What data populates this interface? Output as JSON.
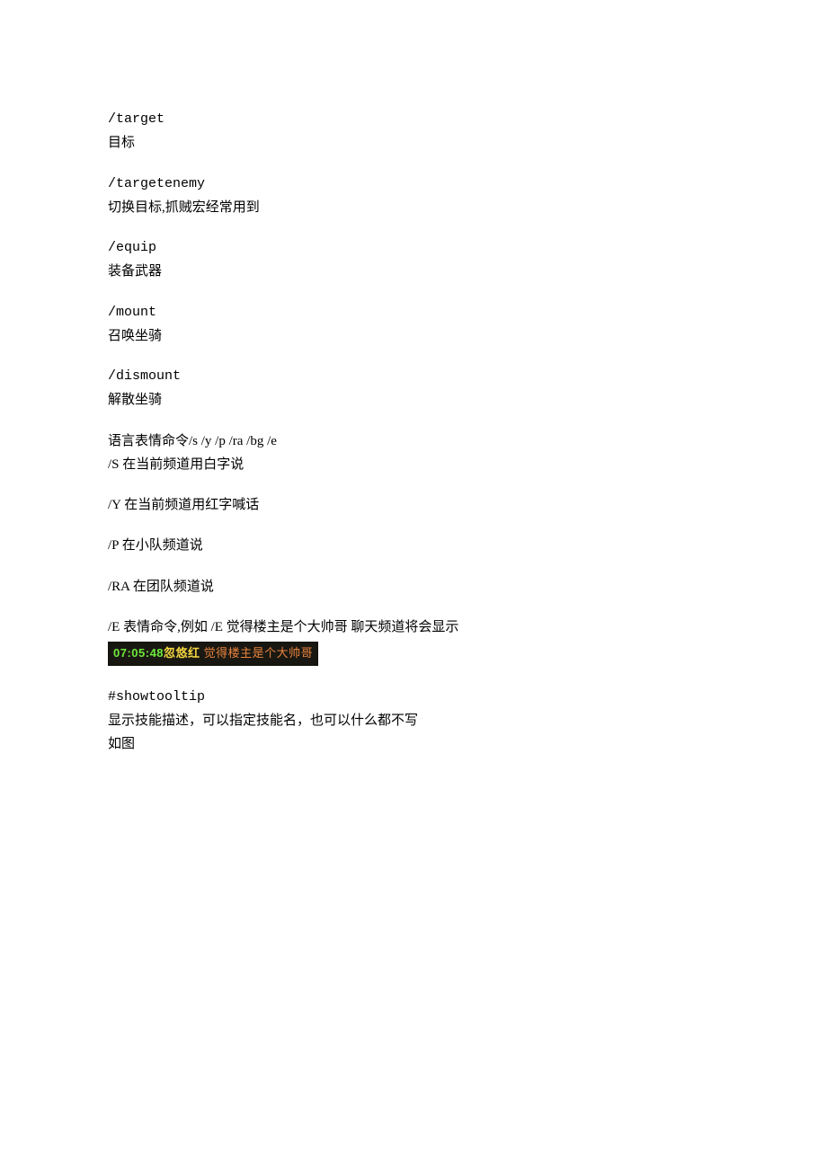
{
  "sections": {
    "target": {
      "cmd": "/target",
      "desc": "目标"
    },
    "targetenemy": {
      "cmd": "/targetenemy",
      "desc": "切换目标,抓贼宏经常用到"
    },
    "equip": {
      "cmd": "/equip",
      "desc": "装备武器"
    },
    "mount": {
      "cmd": "/mount",
      "desc": "召唤坐骑"
    },
    "dismount": {
      "cmd": "/dismount",
      "desc": "解散坐骑"
    },
    "speech": {
      "header": "语言表情命令/s /y /p /ra /bg /e",
      "s": "/S 在当前频道用白字说",
      "y": "/Y 在当前频道用红字喊话",
      "p": "/P 在小队频道说",
      "ra": "/RA 在团队频道说",
      "e": "/E 表情命令,例如 /E 觉得楼主是个大帅哥 聊天频道将会显示"
    },
    "chat": {
      "time": "07:05:48",
      "name": "忽悠红",
      "msg": " 觉得楼主是个大帅哥"
    },
    "showtooltip": {
      "cmd": "#showtooltip",
      "desc": "显示技能描述，可以指定技能名，也可以什么都不写",
      "note": "如图"
    }
  }
}
